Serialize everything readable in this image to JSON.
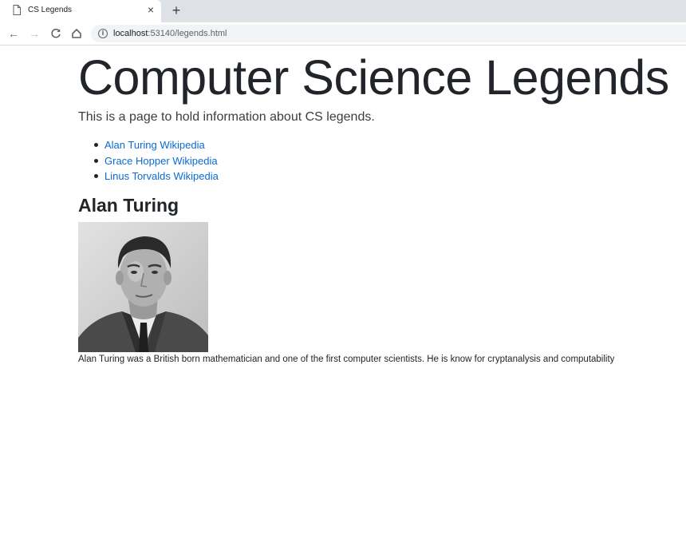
{
  "browser": {
    "tab_title": "CS Legends",
    "close_glyph": "×",
    "new_tab_glyph": "+",
    "back_glyph": "←",
    "forward_glyph": "→",
    "reload_glyph": "C",
    "home_glyph": "⌂",
    "info_glyph": "i",
    "url_host": "localhost",
    "url_path": ":53140/legends.html"
  },
  "page": {
    "title": "Computer Science Legends",
    "lead": "This is a page to hold information about CS legends.",
    "links": [
      {
        "label": "Alan Turing Wikipedia"
      },
      {
        "label": "Grace Hopper Wikipedia"
      },
      {
        "label": "Linus Torvalds Wikipedia"
      }
    ],
    "section_heading": "Alan Turing",
    "bio": "Alan Turing was a British born mathematician and one of the first computer scientists. He is know for cryptanalysis and computability"
  },
  "icons": {
    "tab": "page-icon",
    "close": "close-icon",
    "new_tab": "plus-icon",
    "back": "arrow-left-icon",
    "forward": "arrow-right-icon",
    "reload": "reload-icon",
    "home": "home-icon",
    "info": "info-icon"
  },
  "colors": {
    "link": "#0b6bd0",
    "text": "#212529",
    "tabstrip": "#dee1e6"
  }
}
